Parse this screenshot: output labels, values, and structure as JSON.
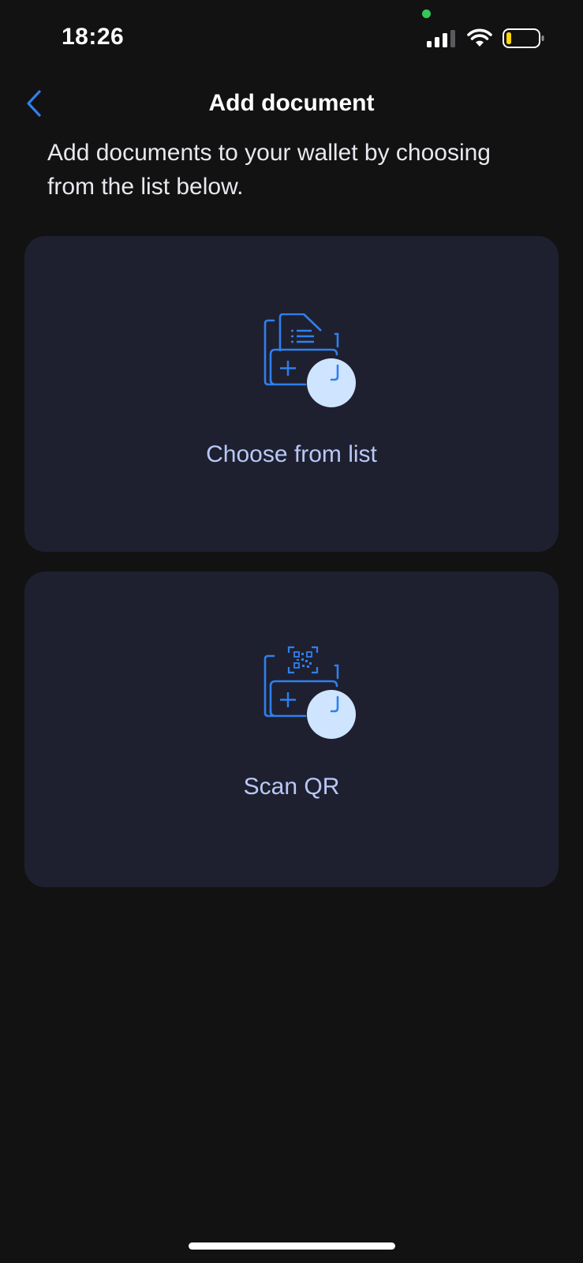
{
  "status_bar": {
    "time": "18:26",
    "icons": [
      "camera-indicator-dot",
      "cellular-signal-icon",
      "wifi-icon",
      "battery-icon"
    ]
  },
  "nav": {
    "title": "Add document",
    "back_icon": "chevron-left-icon"
  },
  "intro": {
    "text": "Add documents to your wallet by choosing from the list below."
  },
  "options": [
    {
      "label": "Choose from list",
      "icon": "document-add-icon"
    },
    {
      "label": "Scan QR",
      "icon": "qr-add-icon"
    }
  ],
  "colors": {
    "background": "#121212",
    "card": "#1e2030",
    "accent": "#2f80ed",
    "label": "#b9c8f5",
    "icon_circle": "#cfe4ff",
    "battery_low": "#ffd60a",
    "camera_dot": "#34c759"
  }
}
